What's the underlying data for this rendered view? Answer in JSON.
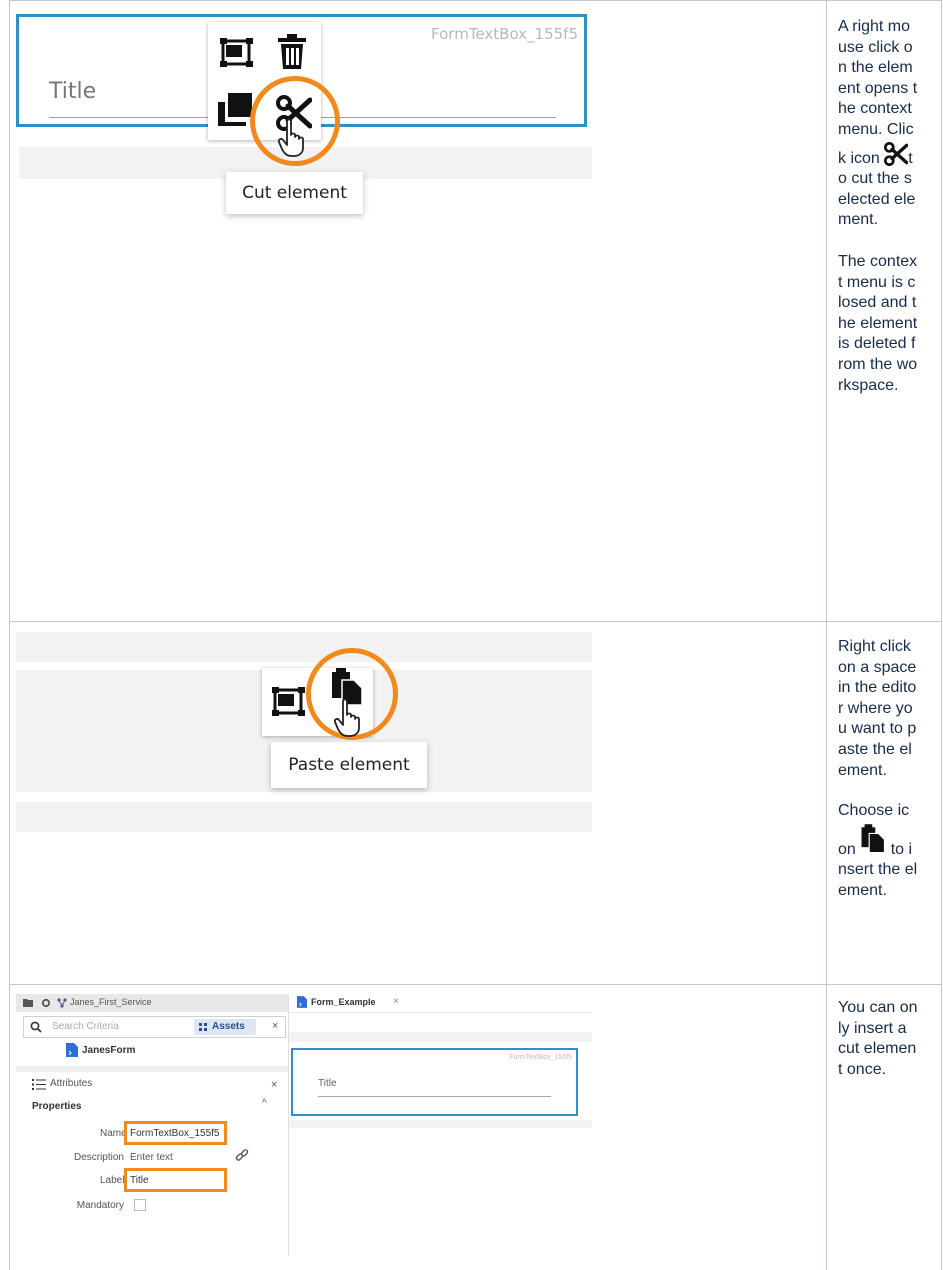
{
  "row1": {
    "element_id": "FormTextBox_155f5",
    "field_label": "Title",
    "tooltip": "Cut element",
    "note_parts": [
      "A right mouse click on the element opens the context menu. Click icon ",
      "to cut the selected element."
    ],
    "note2": "The context menu is closed and the element is deleted from the workspace."
  },
  "row2": {
    "tooltip": "Paste element",
    "note1": "Right click on a space in the editor where you want to paste the element.",
    "note2_before": "Choose icon",
    "note2_after": "to insert the element."
  },
  "row3": {
    "service_name": "Janes_First_Service",
    "search_placeholder": "Search Criteria",
    "assets_label": "Assets",
    "close_symbol": "×",
    "tree_item": "JanesForm",
    "panel_title": "Attributes",
    "section_title": "Properties",
    "name_label": "Name",
    "name_value": "FormTextBox_155f5",
    "description_label": "Description",
    "description_placeholder": "Enter text",
    "label_label": "Label",
    "label_value": "Title",
    "mandatory_label": "Mandatory",
    "tab_label": "Form_Example",
    "canvas_element_id": "FormTextBox_155f5",
    "canvas_field_label": "Title",
    "note": "You can only insert a cut element once."
  },
  "colors": {
    "accent": "#f28a1b",
    "selection_blue": "#2f8fc9",
    "grid": "#c1c7d0"
  }
}
